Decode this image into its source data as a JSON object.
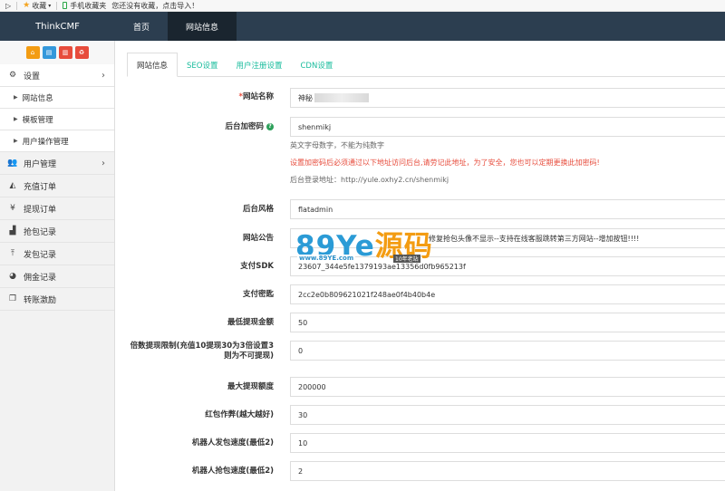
{
  "favbar": {
    "collect_label": "收藏",
    "mobile_label": "手机收藏夹",
    "notice": "您还没有收藏，点击导入！"
  },
  "navbar": {
    "brand": "ThinkCMF",
    "items": [
      {
        "label": "首页"
      },
      {
        "label": "网站信息"
      }
    ]
  },
  "sidebar": {
    "quick_buttons": [
      {
        "icon": "home-icon",
        "color": "#f39c12"
      },
      {
        "icon": "file-icon",
        "color": "#3498db"
      },
      {
        "icon": "trash-icon",
        "color": "#e74c3c"
      },
      {
        "icon": "refresh-icon",
        "color": "#e74c3c"
      }
    ],
    "settings": {
      "label": "设置",
      "icon": "gears-icon"
    },
    "settings_children": [
      {
        "label": "网站信息"
      },
      {
        "label": "模板管理"
      },
      {
        "label": "用户操作管理"
      }
    ],
    "items": [
      {
        "label": "用户管理",
        "icon": "users-icon",
        "has_children": true
      },
      {
        "label": "充值订单",
        "icon": "area-chart-icon"
      },
      {
        "label": "提现订单",
        "icon": "yen-icon"
      },
      {
        "label": "抢包记录",
        "icon": "bar-chart-icon"
      },
      {
        "label": "发包记录",
        "icon": "upload-icon"
      },
      {
        "label": "佣金记录",
        "icon": "pie-chart-icon"
      },
      {
        "label": "转账激励",
        "icon": "clone-icon"
      }
    ]
  },
  "tabs": [
    {
      "label": "网站信息",
      "active": true
    },
    {
      "label": "SEO设置"
    },
    {
      "label": "用户注册设置"
    },
    {
      "label": "CDN设置"
    }
  ],
  "form": {
    "site_name": {
      "required_mark": "*",
      "label": "网站名称",
      "value": "神秘"
    },
    "admin_password": {
      "label": "后台加密码",
      "value": "shenmikj",
      "hint": "英文字母数字，不能为纯数字",
      "warning": "设置加密码后必须通过以下地址访问后台,请劳记此地址，为了安全，您也可以定期更换此加密码!",
      "login_url_label": "后台登录地址：",
      "login_url": "http://yule.oxhy2.cn/shenmikj"
    },
    "admin_style": {
      "label": "后台风格",
      "value": "flatadmin"
    },
    "announcement": {
      "label": "网站公告",
      "value": "修复抢包头像不显示--支持在线客服跳转第三方网站--增加按钮!!!!"
    },
    "pay_sdk": {
      "label": "支付SDK",
      "value": "23607_344e5fe1379193ae13356d0fb965213f"
    },
    "pay_key": {
      "label": "支付密匙",
      "value": "2cc2e0b809621021f248ae0f4b40b4e"
    },
    "min_withdraw": {
      "label": "最低提现金额",
      "value": "50"
    },
    "multiple_limit": {
      "label": "倍数提现限制(充值10提现30为3倍设置3则为不可提现)",
      "value": "0"
    },
    "max_withdraw": {
      "label": "最大提现额度",
      "value": "200000"
    },
    "redpack_cheat": {
      "label": "红包作弊(越大越好)",
      "value": "30"
    },
    "robot_send_speed": {
      "label": "机器人发包速度(最低2)",
      "value": "10"
    },
    "robot_grab_speed": {
      "label": "机器人抢包速度(最低2)",
      "value": "2"
    }
  },
  "watermark": {
    "part1": "89",
    "part2": "Ye",
    "part3": "源码",
    "url": "www.89YE.com",
    "tag": "10年老站"
  }
}
